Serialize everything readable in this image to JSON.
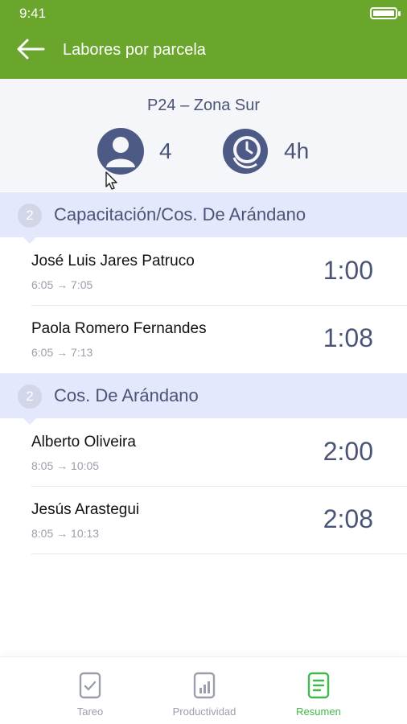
{
  "status_bar": {
    "time": "9:41"
  },
  "app_bar": {
    "title": "Labores por parcela"
  },
  "summary": {
    "plot": "P24 – Zona Sur",
    "workers_count": "4",
    "total_hours": "4h"
  },
  "sections": [
    {
      "badge": "2",
      "title": "Capacitación/Cos. De Arándano",
      "workers": [
        {
          "name": "José Luis Jares Patruco",
          "range": "6:05 → 7:05",
          "duration": "1:00"
        },
        {
          "name": "Paola Romero Fernandes",
          "range": "6:05 → 7:13",
          "duration": "1:08"
        }
      ]
    },
    {
      "badge": "2",
      "title": "Cos. De Arándano",
      "workers": [
        {
          "name": "Alberto Oliveira",
          "range": "8:05 → 10:05",
          "duration": "2:00"
        },
        {
          "name": "Jesús Arastegui",
          "range": "8:05 → 10:13",
          "duration": "2:08"
        }
      ]
    }
  ],
  "bottom_nav": {
    "items": [
      {
        "label": "Tareo",
        "icon": "checklist-icon"
      },
      {
        "label": "Productividad",
        "icon": "bar-chart-icon"
      },
      {
        "label": "Resumen",
        "icon": "document-icon",
        "active": true
      }
    ]
  },
  "colors": {
    "primary_green": "#6aa62b",
    "active_green": "#3fb94a",
    "section_bg": "#e4e8fc",
    "text_accent": "#4a5477"
  }
}
